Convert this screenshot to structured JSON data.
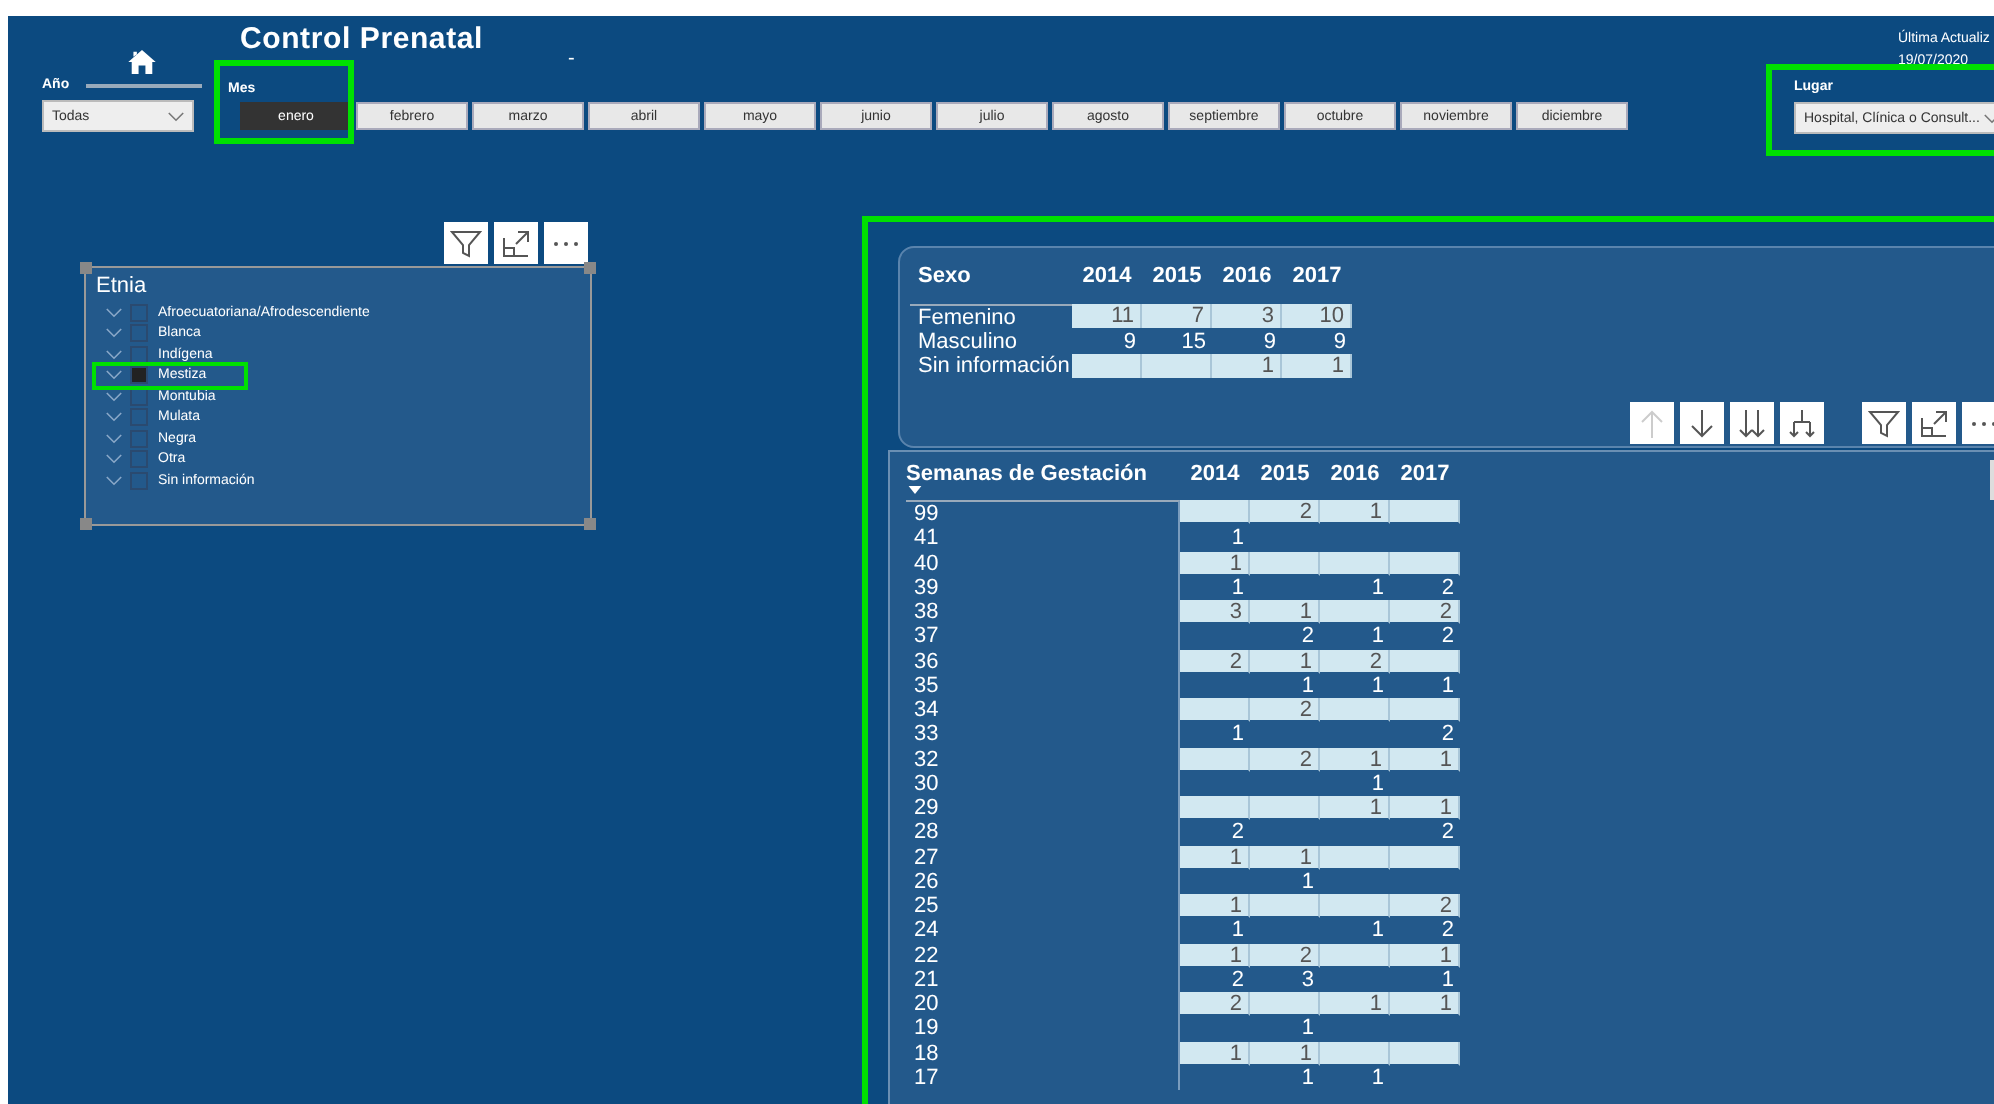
{
  "header": {
    "title": "Control Prenatal",
    "subtitle": "-",
    "last_update_label": "Última Actualiz",
    "last_update_date": "19/07/2020"
  },
  "year_filter": {
    "label": "Año",
    "value": "Todas"
  },
  "month_filter": {
    "label": "Mes",
    "months": [
      {
        "label": "enero",
        "selected": true
      },
      {
        "label": "febrero",
        "selected": false
      },
      {
        "label": "marzo",
        "selected": false
      },
      {
        "label": "abril",
        "selected": false
      },
      {
        "label": "mayo",
        "selected": false
      },
      {
        "label": "junio",
        "selected": false
      },
      {
        "label": "julio",
        "selected": false
      },
      {
        "label": "agosto",
        "selected": false
      },
      {
        "label": "septiembre",
        "selected": false
      },
      {
        "label": "octubre",
        "selected": false
      },
      {
        "label": "noviembre",
        "selected": false
      },
      {
        "label": "diciembre",
        "selected": false
      }
    ]
  },
  "place_filter": {
    "label": "Lugar",
    "value": "Hospital, Clínica o Consult..."
  },
  "ethnicity_slicer": {
    "title": "Etnia",
    "items": [
      {
        "label": "Afroecuatoriana/Afrodescendiente",
        "checked": false
      },
      {
        "label": "Blanca",
        "checked": false
      },
      {
        "label": "Indígena",
        "checked": false
      },
      {
        "label": "Mestiza",
        "checked": true
      },
      {
        "label": "Montubia",
        "checked": false
      },
      {
        "label": "Mulata",
        "checked": false
      },
      {
        "label": "Negra",
        "checked": false
      },
      {
        "label": "Otra",
        "checked": false
      },
      {
        "label": "Sin información",
        "checked": false
      }
    ]
  },
  "sex_table": {
    "title": "Sexo",
    "columns": [
      "2014",
      "2015",
      "2016",
      "2017"
    ],
    "rows": [
      {
        "label": "Femenino",
        "cells": [
          {
            "value": "11"
          },
          {
            "value": "7"
          },
          {
            "value": "3"
          },
          {
            "value": "10"
          }
        ]
      },
      {
        "label": "Masculino",
        "cells": [
          {
            "value": "9"
          },
          {
            "value": "15"
          },
          {
            "value": "9"
          },
          {
            "value": "9"
          }
        ]
      },
      {
        "label": "Sin información",
        "cells": [
          {
            "blank": true
          },
          {
            "blank": true
          },
          {
            "value": "1"
          },
          {
            "value": "1"
          }
        ]
      }
    ]
  },
  "weeks_table": {
    "title": "Semanas de Gestación",
    "columns": [
      "2014",
      "2015",
      "2016",
      "2017"
    ],
    "rows": [
      {
        "label": "99",
        "cells": [
          {
            "blank": true
          },
          {
            "value": "2"
          },
          {
            "value": "1"
          },
          {
            "blank": true
          }
        ]
      },
      {
        "label": "41",
        "cells": [
          {
            "value": "1"
          },
          {
            "blank": true
          },
          {
            "blank": true
          },
          {
            "blank": true
          }
        ]
      },
      {
        "label": "40",
        "cells": [
          {
            "value": "1"
          },
          {
            "blank": true
          },
          {
            "blank": true
          },
          {
            "blank": true
          }
        ]
      },
      {
        "label": "39",
        "cells": [
          {
            "value": "1"
          },
          {
            "blank": true
          },
          {
            "value": "1"
          },
          {
            "value": "2"
          }
        ]
      },
      {
        "label": "38",
        "cells": [
          {
            "value": "3"
          },
          {
            "value": "1"
          },
          {
            "blank": true
          },
          {
            "value": "2"
          }
        ]
      },
      {
        "label": "37",
        "cells": [
          {
            "blank": true
          },
          {
            "value": "2"
          },
          {
            "value": "1"
          },
          {
            "value": "2"
          }
        ]
      },
      {
        "label": "36",
        "cells": [
          {
            "value": "2"
          },
          {
            "value": "1"
          },
          {
            "value": "2"
          },
          {
            "blank": true
          }
        ]
      },
      {
        "label": "35",
        "cells": [
          {
            "blank": true
          },
          {
            "value": "1"
          },
          {
            "value": "1"
          },
          {
            "value": "1"
          }
        ]
      },
      {
        "label": "34",
        "cells": [
          {
            "blank": true
          },
          {
            "value": "2"
          },
          {
            "blank": true
          },
          {
            "blank": true
          }
        ]
      },
      {
        "label": "33",
        "cells": [
          {
            "value": "1"
          },
          {
            "blank": true
          },
          {
            "blank": true
          },
          {
            "value": "2"
          }
        ]
      },
      {
        "label": "32",
        "cells": [
          {
            "blank": true
          },
          {
            "value": "2"
          },
          {
            "value": "1"
          },
          {
            "value": "1"
          }
        ]
      },
      {
        "label": "30",
        "cells": [
          {
            "blank": true
          },
          {
            "blank": true
          },
          {
            "value": "1"
          },
          {
            "blank": true
          }
        ]
      },
      {
        "label": "29",
        "cells": [
          {
            "blank": true
          },
          {
            "blank": true
          },
          {
            "value": "1"
          },
          {
            "value": "1"
          }
        ]
      },
      {
        "label": "28",
        "cells": [
          {
            "value": "2"
          },
          {
            "blank": true
          },
          {
            "blank": true
          },
          {
            "value": "2"
          }
        ]
      },
      {
        "label": "27",
        "cells": [
          {
            "value": "1"
          },
          {
            "value": "1"
          },
          {
            "blank": true
          },
          {
            "blank": true
          }
        ]
      },
      {
        "label": "26",
        "cells": [
          {
            "blank": true
          },
          {
            "value": "1"
          },
          {
            "blank": true
          },
          {
            "blank": true
          }
        ]
      },
      {
        "label": "25",
        "cells": [
          {
            "value": "1"
          },
          {
            "blank": true
          },
          {
            "blank": true
          },
          {
            "value": "2"
          }
        ]
      },
      {
        "label": "24",
        "cells": [
          {
            "value": "1"
          },
          {
            "blank": true
          },
          {
            "value": "1"
          },
          {
            "value": "2"
          }
        ]
      },
      {
        "label": "22",
        "cells": [
          {
            "value": "1"
          },
          {
            "value": "2"
          },
          {
            "blank": true
          },
          {
            "value": "1"
          }
        ]
      },
      {
        "label": "21",
        "cells": [
          {
            "value": "2"
          },
          {
            "value": "3"
          },
          {
            "blank": true
          },
          {
            "value": "1"
          }
        ]
      },
      {
        "label": "20",
        "cells": [
          {
            "value": "2"
          },
          {
            "blank": true
          },
          {
            "value": "1"
          },
          {
            "value": "1"
          }
        ]
      },
      {
        "label": "19",
        "cells": [
          {
            "blank": true
          },
          {
            "value": "1"
          },
          {
            "blank": true
          },
          {
            "blank": true
          }
        ]
      },
      {
        "label": "18",
        "cells": [
          {
            "value": "1"
          },
          {
            "value": "1"
          },
          {
            "blank": true
          },
          {
            "blank": true
          }
        ]
      },
      {
        "label": "17",
        "cells": [
          {
            "blank": true
          },
          {
            "value": "1"
          },
          {
            "value": "1"
          },
          {
            "blank": true
          }
        ]
      }
    ]
  }
}
